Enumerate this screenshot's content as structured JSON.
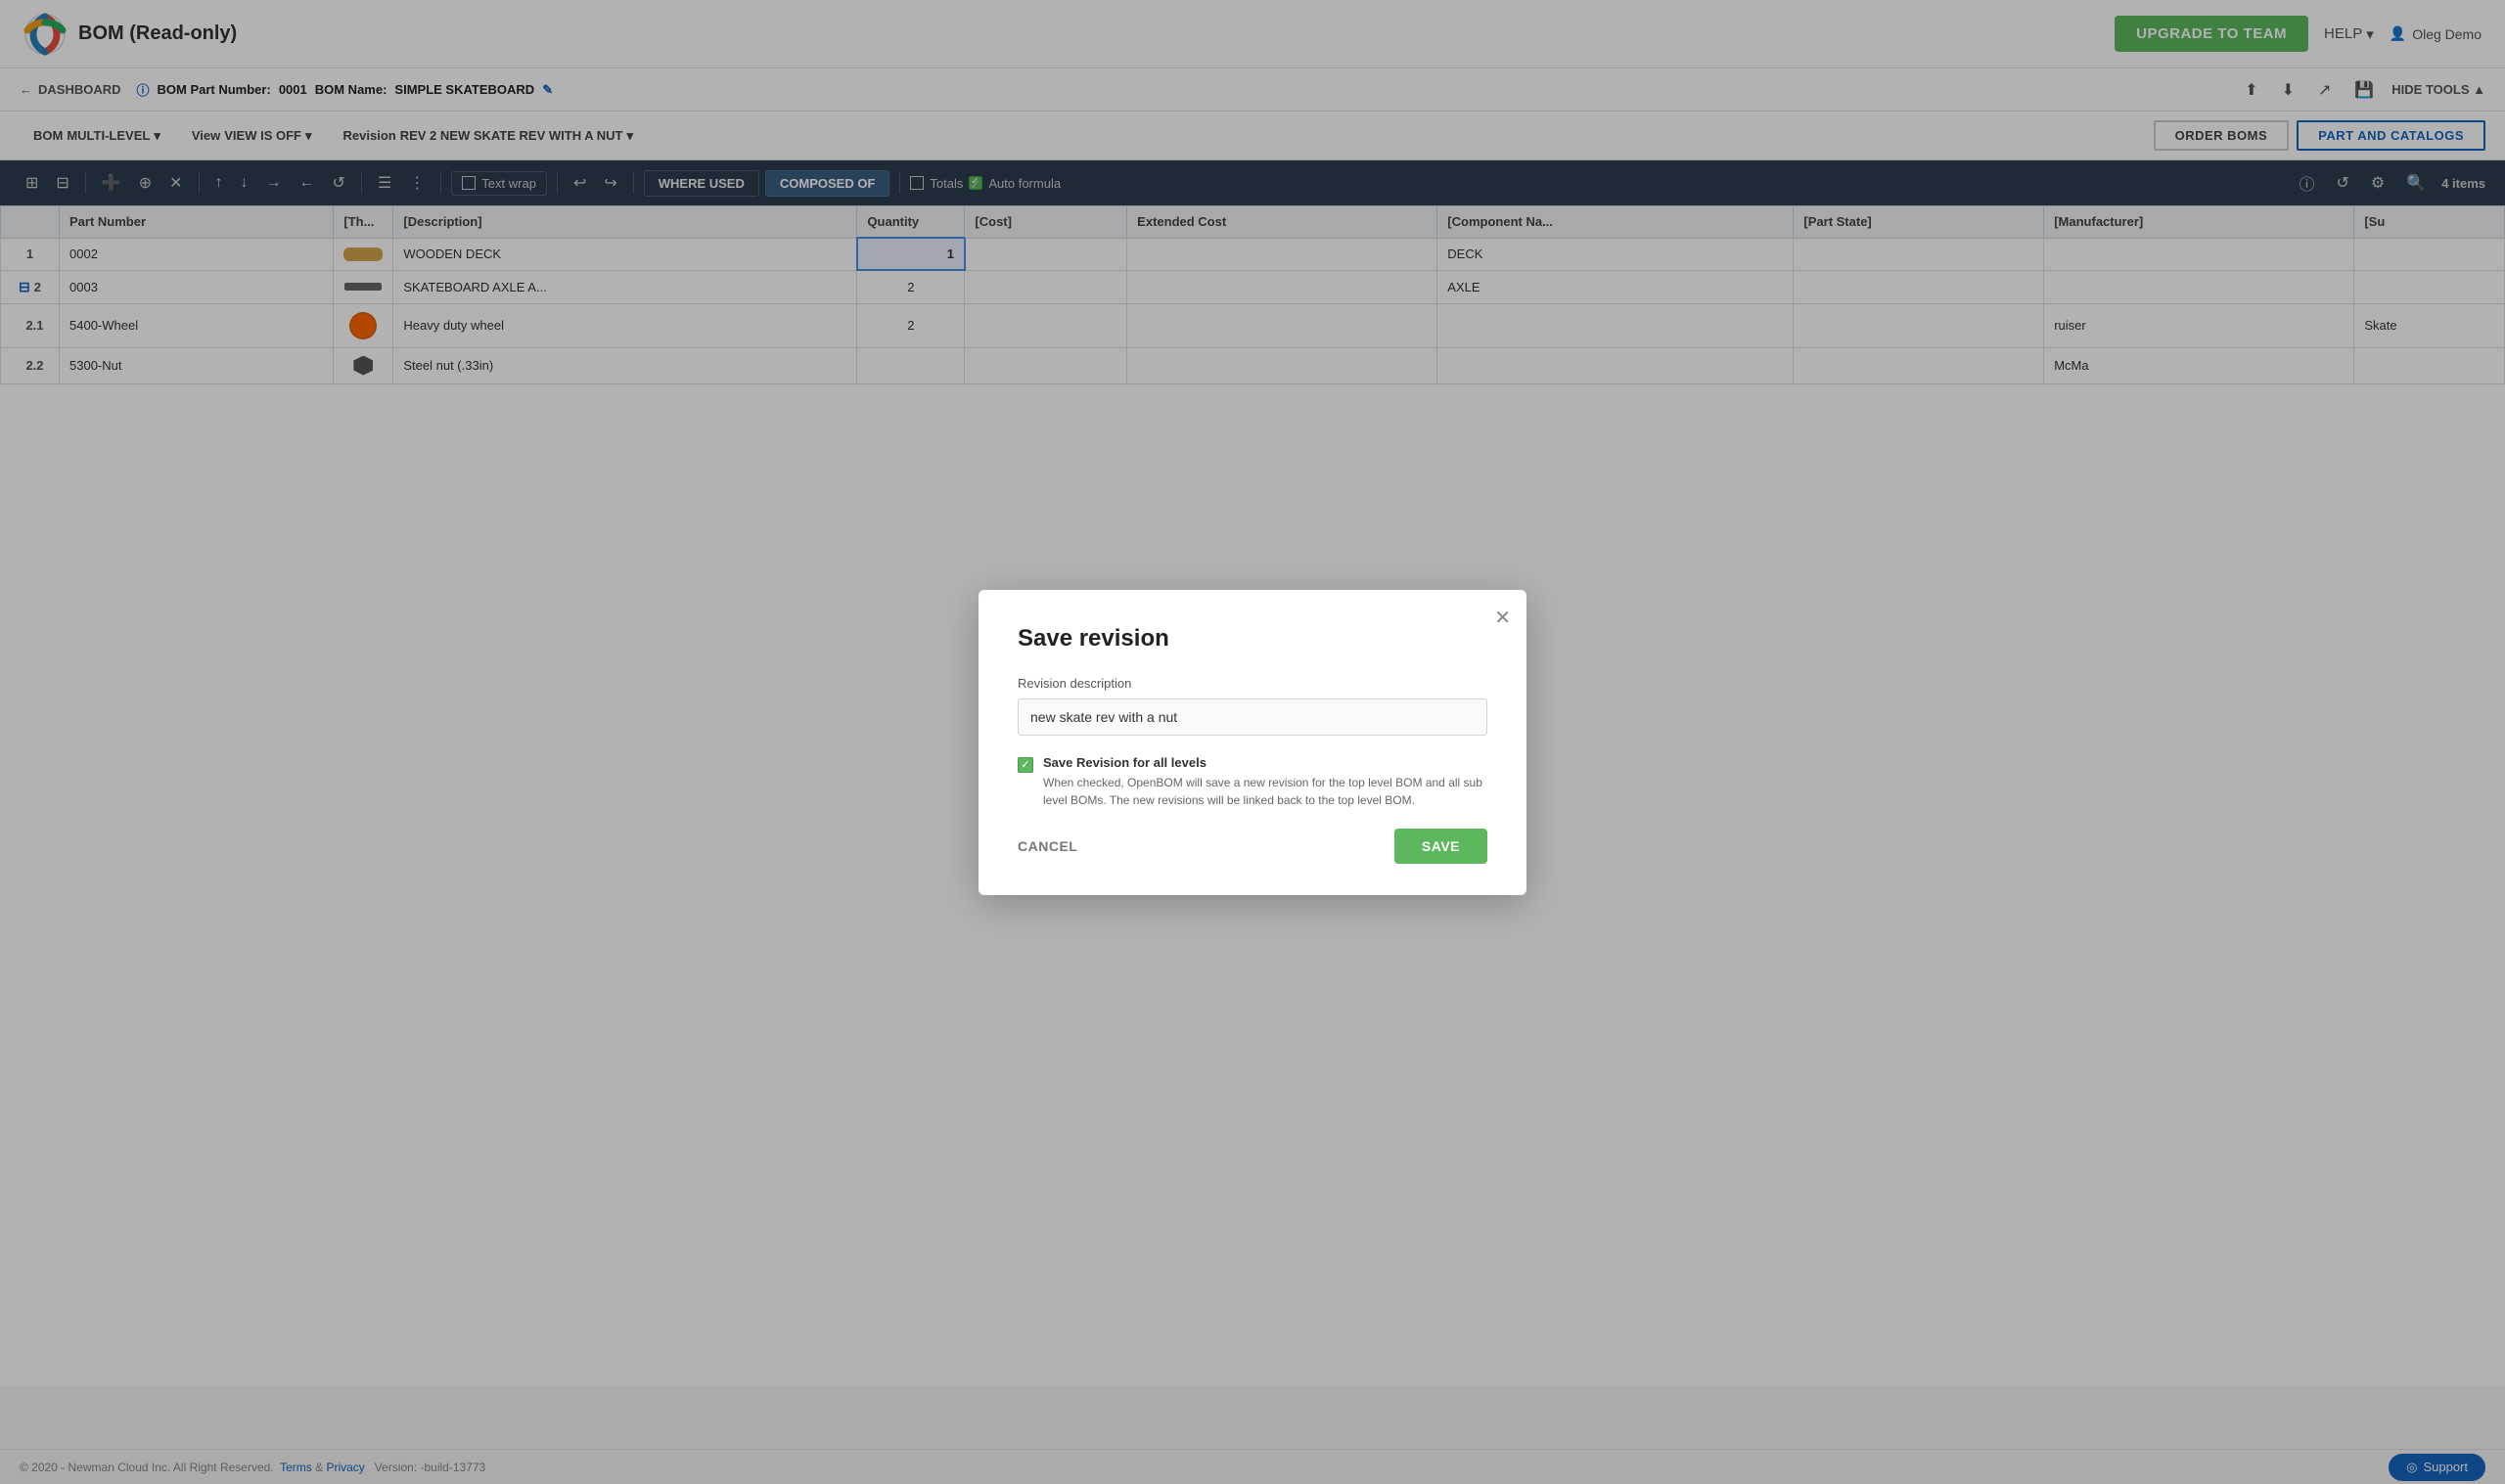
{
  "header": {
    "title": "BOM (Read-only)",
    "upgrade_label": "UPGRADE TO TEAM",
    "help_label": "HELP",
    "user_name": "Oleg Demo"
  },
  "breadcrumb": {
    "dashboard_label": "DASHBOARD",
    "bom_part_number_label": "BOM Part Number:",
    "bom_part_number_value": "0001",
    "bom_name_label": "BOM Name:",
    "bom_name_value": "SIMPLE SKATEBOARD",
    "hide_tools_label": "HIDE TOOLS"
  },
  "toolbar": {
    "bom_label": "BOM",
    "bom_type": "MULTI-LEVEL",
    "view_label": "View",
    "view_value": "VIEW IS OFF",
    "revision_label": "Revision",
    "revision_value": "REV 2 NEW SKATE REV WITH A NUT",
    "order_boms_label": "ORDER BOMS",
    "part_catalogs_label": "PART AND CATALOGS"
  },
  "secondary_toolbar": {
    "text_wrap_label": "Text wrap",
    "where_used_label": "WHERE USED",
    "composed_of_label": "COMPOSED OF",
    "totals_label": "Totals",
    "auto_formula_label": "Auto formula",
    "items_count": "4 items"
  },
  "table": {
    "columns": [
      "Part Number",
      "[Th...",
      "[Description]",
      "Quantity",
      "[Cost]",
      "Extended Cost",
      "[Component Na...",
      "[Part State]",
      "[Manufacturer]",
      "[Su"
    ],
    "rows": [
      {
        "level": "1",
        "part_number": "0002",
        "thumbnail": "deck",
        "description": "WOODEN DECK",
        "quantity": "1",
        "cost": "",
        "extended_cost": "",
        "component_name": "DECK",
        "part_state": "",
        "manufacturer": "",
        "su": ""
      },
      {
        "level": "2",
        "part_number": "0003",
        "thumbnail": "axle",
        "description": "SKATEBOARD AXLE A...",
        "quantity": "2",
        "cost": "",
        "extended_cost": "",
        "component_name": "AXLE",
        "part_state": "",
        "manufacturer": "",
        "su": ""
      },
      {
        "level": "2.1",
        "part_number": "5400-Wheel",
        "thumbnail": "wheel",
        "description": "Heavy duty wheel",
        "quantity": "2",
        "cost": "",
        "extended_cost": "",
        "component_name": "",
        "part_state": "",
        "manufacturer": "ruiser",
        "su": "Skate"
      },
      {
        "level": "2.2",
        "part_number": "5300-Nut",
        "thumbnail": "nut",
        "description": "Steel nut (.33in)",
        "quantity": "",
        "cost": "",
        "extended_cost": "",
        "component_name": "",
        "part_state": "",
        "manufacturer": "McMa",
        "su": ""
      }
    ]
  },
  "modal": {
    "title": "Save revision",
    "revision_description_label": "Revision description",
    "revision_description_value": "new skate rev with a nut",
    "save_all_levels_label": "Save Revision for all levels",
    "save_all_levels_desc": "When checked, OpenBOM will save a new revision for the top level BOM and all sub level BOMs. The new revisions will be linked back to the top level BOM.",
    "cancel_label": "CANCEL",
    "save_label": "SAVE"
  },
  "footer": {
    "copyright": "© 2020 - Newman Cloud Inc. All Right Reserved.",
    "terms_label": "Terms",
    "privacy_label": "Privacy",
    "version": "Version: -build-13773",
    "support_label": "Support"
  }
}
